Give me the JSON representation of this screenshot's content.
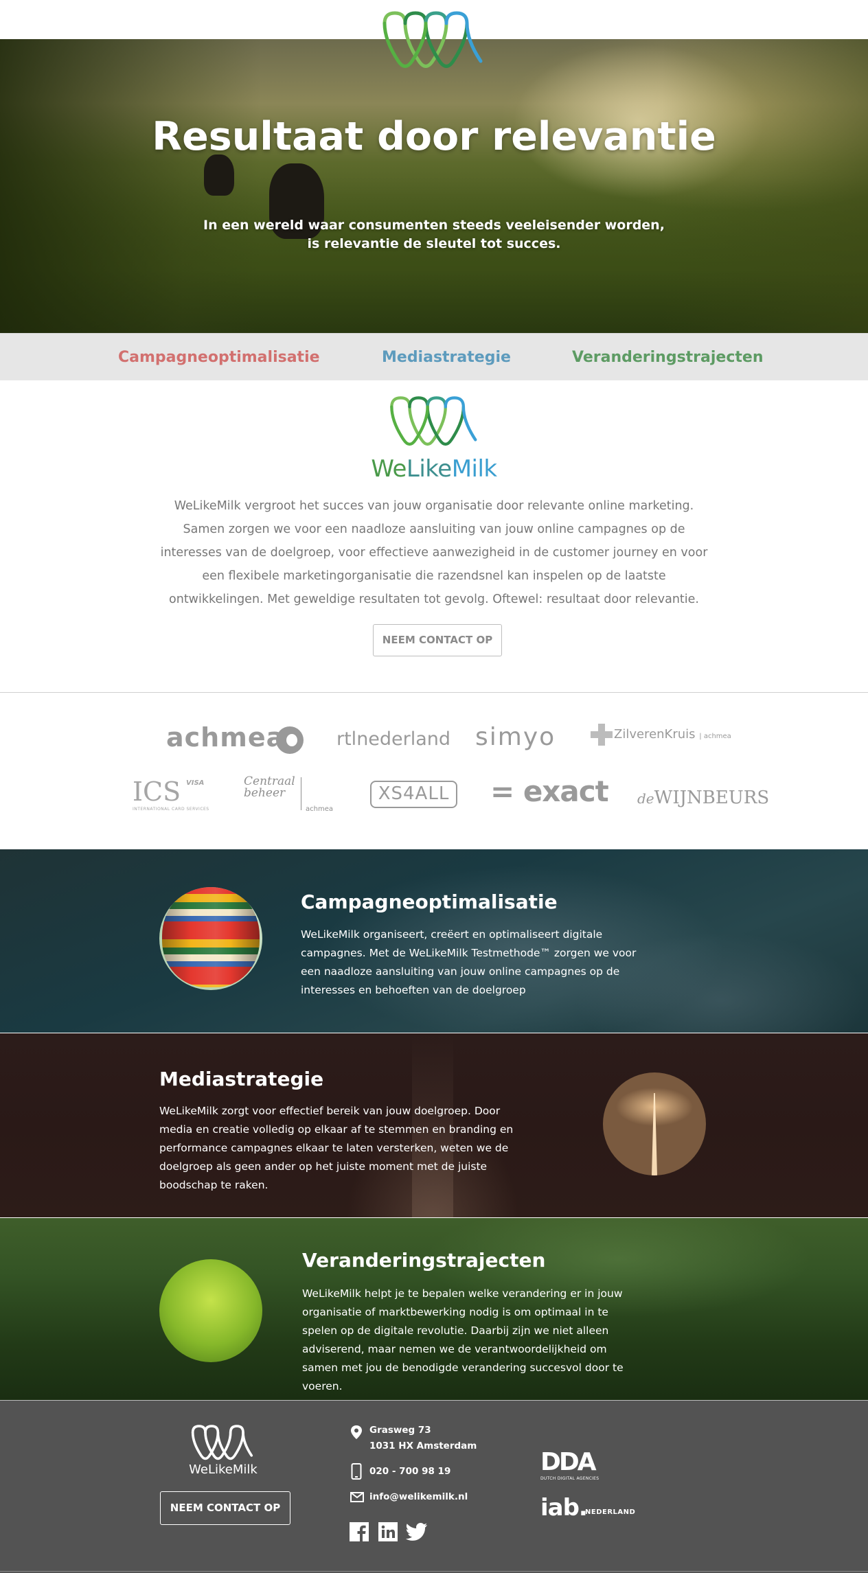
{
  "header": {
    "logo_icon": "welikemilk-drops-logo"
  },
  "hero": {
    "title": "Resultaat door relevantie",
    "subtitle_line1": "In een wereld waar consumenten steeds veeleisender worden,",
    "subtitle_line2": "is relevantie de sleutel tot succes."
  },
  "nav": {
    "items": [
      {
        "label": "Campagneoptimalisatie",
        "color": "#d2706f"
      },
      {
        "label": "Mediastrategie",
        "color": "#5d9bbd"
      },
      {
        "label": "Veranderingstrajecten",
        "color": "#5d9b63"
      }
    ]
  },
  "intro": {
    "brand_we": "We",
    "brand_like": "Like",
    "brand_milk": "Milk",
    "text": "WeLikeMilk vergroot het succes van jouw organisatie door relevante online marketing. Samen zorgen we voor een naadloze aansluiting van jouw online campagnes op de interesses van de doelgroep, voor effectieve aanwezigheid in de customer journey en voor een flexibele marketingorganisatie die razendsnel kan inspelen op de laatste ontwikkelingen. Met geweldige resultaten tot gevolg. Oftewel: resultaat door relevantie.",
    "cta": "NEEM CONTACT OP"
  },
  "clients": {
    "achmea": "achmea",
    "rtl": "rtlnederland",
    "simyo": "simyo",
    "zk_main": "ZilverenKruis",
    "zk_sub": "| achmea",
    "ics": "ICS",
    "ics_visa": "VISA",
    "ics_sub": "INTERNATIONAL CARD SERVICES",
    "cb_line1": "Centraal",
    "cb_line2": "beheer",
    "cb_sub": "achmea",
    "xs4all": "XS4ALL",
    "exact": "= exact",
    "wijn_de": "de",
    "wijn_main": "WIJNBEURS"
  },
  "sections": [
    {
      "title": "Campagneoptimalisatie",
      "text": "WeLikeMilk organiseert, creëert en optimaliseert digitale campagnes. Met de WeLikeMilk Testmethode™ zorgen we voor een naadloze aansluiting van jouw online campagnes op de interesses en behoeften van de doelgroep"
    },
    {
      "title": "Mediastrategie",
      "text": "WeLikeMilk zorgt voor effectief bereik van jouw doelgroep. Door media en creatie volledig op elkaar af te stemmen en branding en performance campagnes elkaar te laten versterken, weten we de doelgroep als geen ander op het juiste moment met de juiste boodschap te raken."
    },
    {
      "title": "Veranderingstrajecten",
      "text": "WeLikeMilk helpt je te bepalen welke verandering er in jouw organisatie of marktbewerking nodig is om optimaal in te spelen op de digitale revolutie. Daarbij zijn we niet alleen adviserend, maar nemen we de verantwoordelijkheid om samen met jou de benodigde verandering succesvol door te voeren."
    }
  ],
  "footer": {
    "brand": "WeLikeMilk",
    "cta": "NEEM CONTACT OP",
    "address_line1": "Grasweg 73",
    "address_line2": "1031 HX Amsterdam",
    "phone": "020 - 700 98 19",
    "email": "info@welikemilk.nl",
    "dda": "DDA",
    "dda_sub": "DUTCH DIGITAL AGENCIES",
    "iab": "iab.",
    "iab_sub": "NEDERLAND"
  }
}
